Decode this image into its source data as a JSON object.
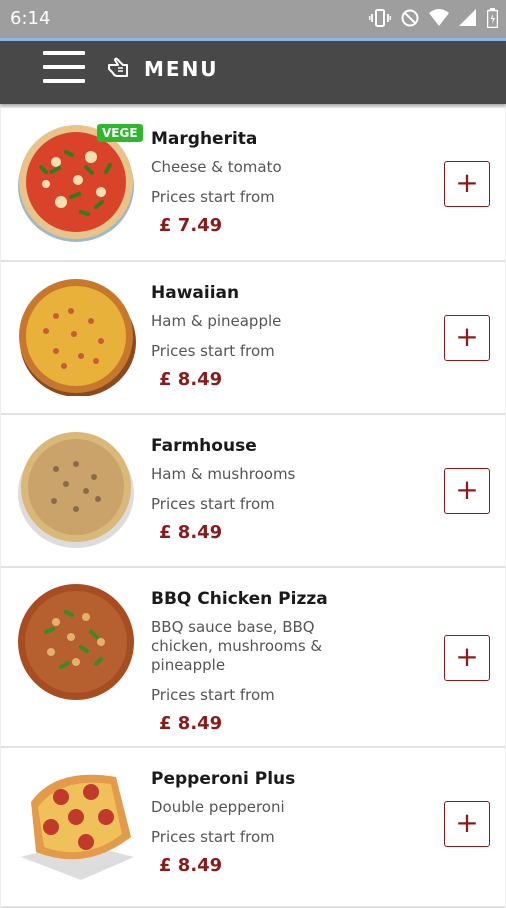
{
  "status_bar": {
    "time": "6:14"
  },
  "app_bar": {
    "title": "MENU"
  },
  "items": [
    {
      "name": "Margherita",
      "description": "Cheese & tomato",
      "prices_label": "Prices start from",
      "price": "£ 7.49",
      "badge": "VEGE",
      "add_label": "+"
    },
    {
      "name": "Hawaiian",
      "description": "Ham & pineapple",
      "prices_label": "Prices start from",
      "price": "£ 8.49",
      "add_label": "+"
    },
    {
      "name": "Farmhouse",
      "description": "Ham & mushrooms",
      "prices_label": "Prices start from",
      "price": "£ 8.49",
      "add_label": "+"
    },
    {
      "name": "BBQ Chicken Pizza",
      "description_lines": [
        "BBQ sauce base, BBQ",
        "chicken, mushrooms &",
        "pineapple"
      ],
      "prices_label": "Prices start from",
      "price": "£ 8.49",
      "add_label": "+"
    },
    {
      "name": "Pepperoni Plus",
      "description": "Double pepperoni",
      "prices_label": "Prices start from",
      "price": "£ 8.49",
      "add_label": "+"
    }
  ],
  "colors": {
    "app_bar": "#484848",
    "status_bar": "#9e9e9e",
    "price": "#8b1a1a",
    "badge": "#2eb82e"
  }
}
